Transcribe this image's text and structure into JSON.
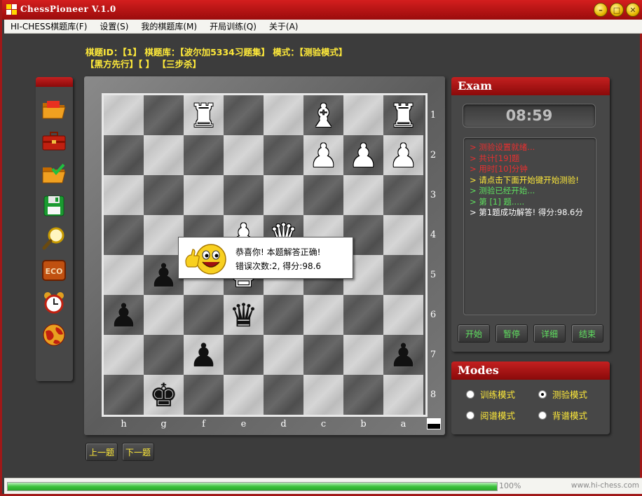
{
  "window": {
    "title": "ChessPioneer V.1.0"
  },
  "menu": [
    "HI-CHESS棋题库(F)",
    "设置(S)",
    "我的棋题库(M)",
    "开局训练(Q)",
    "关于(A)"
  ],
  "info": {
    "line1": "棋题ID：【1】 棋题库：【波尔加5334习题集】 模式：【测验模式】",
    "line2": "【黑方先行】【 】 【三步杀】"
  },
  "toolbar_icons": [
    "folder-open-icon",
    "briefcase-icon",
    "folder-check-icon",
    "floppy-disk-icon",
    "magnifier-icon",
    "eco-icon",
    "alarm-clock-icon",
    "globe-icon"
  ],
  "board": {
    "files": [
      "h",
      "g",
      "f",
      "e",
      "d",
      "c",
      "b",
      "a"
    ],
    "ranks": [
      "1",
      "2",
      "3",
      "4",
      "5",
      "6",
      "7",
      "8"
    ],
    "pieces": [
      {
        "sq": "f1",
        "color": "white",
        "glyph": "♜",
        "name": "white-rook"
      },
      {
        "sq": "c1",
        "color": "white",
        "glyph": "♝",
        "name": "white-bishop"
      },
      {
        "sq": "a1",
        "color": "white",
        "glyph": "♜",
        "name": "white-rook"
      },
      {
        "sq": "c2",
        "color": "white",
        "glyph": "♟",
        "name": "white-pawn"
      },
      {
        "sq": "b2",
        "color": "white",
        "glyph": "♟",
        "name": "white-pawn"
      },
      {
        "sq": "a2",
        "color": "white",
        "glyph": "♟",
        "name": "white-pawn"
      },
      {
        "sq": "e4",
        "color": "white",
        "glyph": "♟",
        "name": "white-pawn"
      },
      {
        "sq": "d4",
        "color": "white",
        "glyph": "♛",
        "name": "white-queen"
      },
      {
        "sq": "e5",
        "color": "white",
        "glyph": "♚",
        "name": "white-king"
      },
      {
        "sq": "g5",
        "color": "black",
        "glyph": "♟",
        "name": "black-pawn"
      },
      {
        "sq": "h6",
        "color": "black",
        "glyph": "♟",
        "name": "black-pawn"
      },
      {
        "sq": "e6",
        "color": "black",
        "glyph": "♛",
        "name": "black-queen"
      },
      {
        "sq": "f7",
        "color": "black",
        "glyph": "♟",
        "name": "black-pawn"
      },
      {
        "sq": "a7",
        "color": "black",
        "glyph": "♟",
        "name": "black-pawn"
      },
      {
        "sq": "g8",
        "color": "black",
        "glyph": "♚",
        "name": "black-king"
      }
    ]
  },
  "popup": {
    "line1": "恭喜你! 本题解答正确!",
    "line2": "错误次数:2, 得分:98.6"
  },
  "nav": {
    "prev": "上一题",
    "next": "下一题"
  },
  "exam": {
    "title": "Exam",
    "timer": "08:59",
    "log": [
      {
        "text": "> 测验设置就绪...",
        "color": "#e83030"
      },
      {
        "text": "> 共计[19]题",
        "color": "#e83030"
      },
      {
        "text": "> 用时[10]分钟",
        "color": "#e83030"
      },
      {
        "text": "> 请点击下面开始键开始测验!",
        "color": "#ffea3a"
      },
      {
        "text": "> 测验已经开始...",
        "color": "#5fe05f"
      },
      {
        "text": "> 第 [1] 题.....",
        "color": "#5fe05f"
      },
      {
        "text": "> 第1题成功解答! 得分:98.6分",
        "color": "#ffffff"
      }
    ],
    "buttons": [
      "开始",
      "暂停",
      "详细",
      "结束"
    ]
  },
  "modes": {
    "title": "Modes",
    "options": [
      {
        "label": "训练模式",
        "selected": false
      },
      {
        "label": "测验模式",
        "selected": true
      },
      {
        "label": "阅谱模式",
        "selected": false
      },
      {
        "label": "背谱模式",
        "selected": false
      }
    ]
  },
  "status": {
    "progress": 1.0,
    "progress_label": "100%",
    "site": "www.hi-chess.com"
  }
}
